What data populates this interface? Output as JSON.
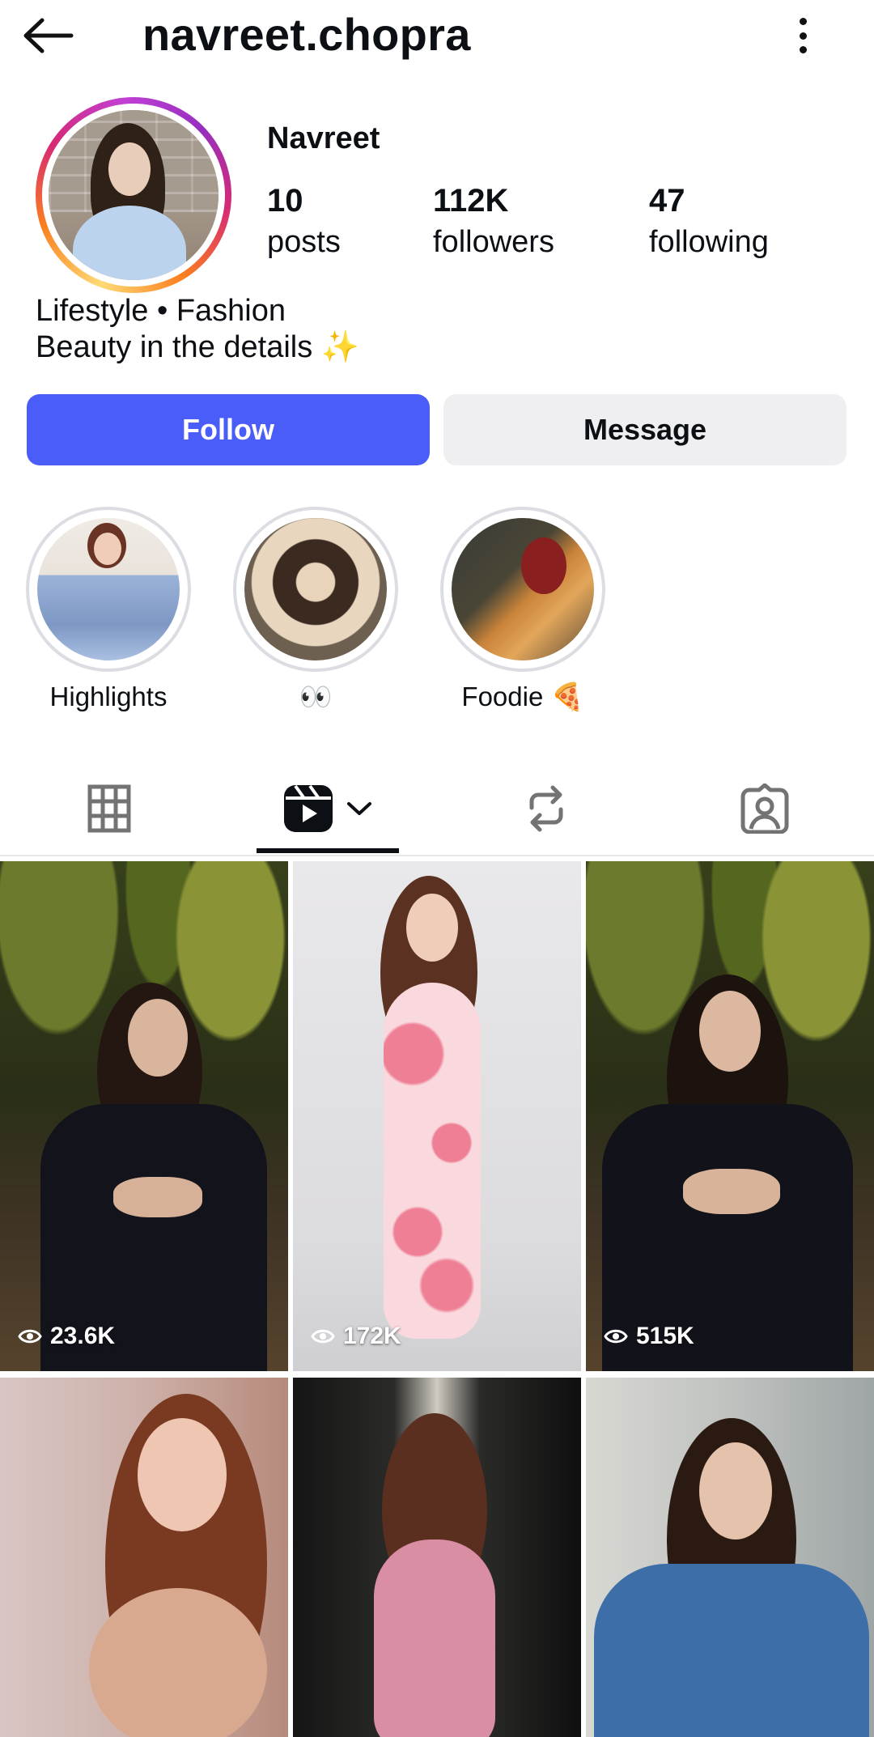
{
  "header": {
    "username": "navreet.chopra"
  },
  "profile": {
    "display_name": "Navreet",
    "stats": {
      "posts": {
        "value": "10",
        "label": "posts"
      },
      "followers": {
        "value": "112K",
        "label": "followers"
      },
      "following": {
        "value": "47",
        "label": "following"
      }
    },
    "bio": {
      "line1": "Lifestyle • Fashion",
      "line2": "Beauty in the details ✨"
    }
  },
  "actions": {
    "follow_label": "Follow",
    "message_label": "Message",
    "follow_color": "#4a5df9"
  },
  "highlights": [
    {
      "label": "Highlights"
    },
    {
      "label": "👀"
    },
    {
      "label": "Foodie 🍕"
    }
  ],
  "tabs": {
    "active": "reels",
    "items": [
      "grid-icon",
      "reels-icon",
      "reposts-icon",
      "tagged-icon"
    ]
  },
  "grid": {
    "items": [
      {
        "views": "23.6K"
      },
      {
        "views": "172K"
      },
      {
        "views": "515K"
      },
      {
        "views": ""
      },
      {
        "views": ""
      },
      {
        "views": ""
      }
    ]
  }
}
